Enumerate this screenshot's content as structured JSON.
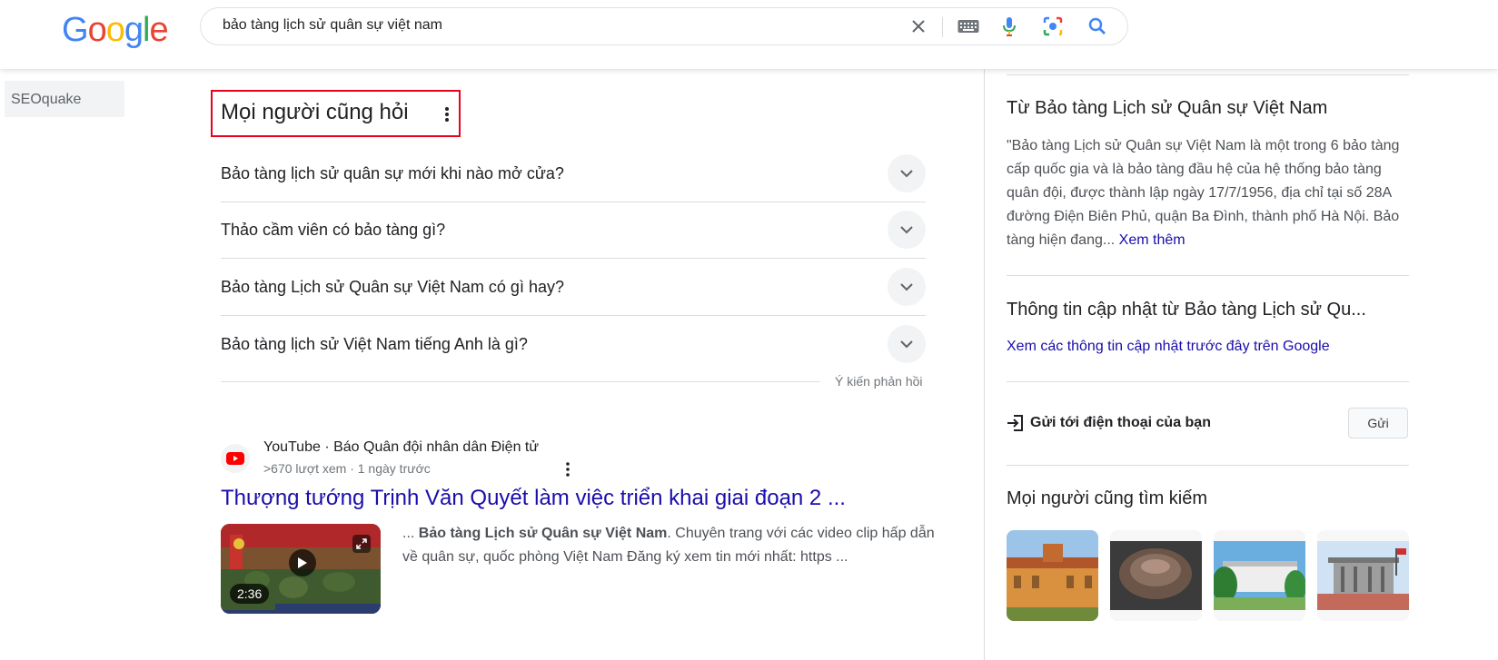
{
  "logo": {
    "letters": [
      "G",
      "o",
      "o",
      "g",
      "l",
      "e"
    ],
    "colors": [
      "#4285f4",
      "#ea4335",
      "#fbbc05",
      "#4285f4",
      "#34a853",
      "#ea4335"
    ]
  },
  "search": {
    "query": "bảo tàng lịch sử quân sự việt nam",
    "icons": [
      "close-icon",
      "keyboard-icon",
      "microphone-icon",
      "lens-icon",
      "search-icon"
    ]
  },
  "seoquake": {
    "label": "SEOquake",
    "enabled": false
  },
  "paa": {
    "title": "Mọi người cũng hỏi",
    "questions": [
      "Bảo tàng lịch sử quân sự mới khi nào mở cửa?",
      "Thảo cầm viên có bảo tàng gì?",
      "Bảo tàng Lịch sử Quân sự Việt Nam có gì hay?",
      "Bảo tàng lịch sử Việt Nam tiếng Anh là gì?"
    ],
    "feedback": "Ý kiến phản hồi"
  },
  "result": {
    "source": "YouTube · Báo Quân đội nhân dân Điện tử",
    "meta": ">670 lượt xem · 1 ngày trước",
    "title": "Thượng tướng Trịnh Văn Quyết làm việc triển khai giai đoạn 2 ...",
    "duration": "2:36",
    "snippet_prefix": "... ",
    "snippet_bold": "Bảo tàng Lịch sử Quân sự Việt Nam",
    "snippet_rest": ". Chuyên trang với các video clip hấp dẫn về quân sự, quốc phòng Việt Nam Đăng ký xem tin mới nhất: https ..."
  },
  "panel": {
    "from_heading": "Từ Bảo tàng Lịch sử Quân sự Việt Nam",
    "description": "\"Bảo tàng Lịch sử Quân sự Việt Nam là một trong 6 bảo tàng cấp quốc gia và là bảo tàng đầu hệ của hệ thống bảo tàng quân đội, được thành lập ngày 17/7/1956, địa chỉ tại số 28A đường Điện Biên Phủ, quận Ba Đình, thành phố Hà Nội. Bảo tàng hiện đang... ",
    "more": "Xem thêm",
    "updates_heading": "Thông tin cập nhật từ Bảo tàng Lịch sử Qu...",
    "updates_link": "Xem các thông tin cập nhật trước đây trên Google",
    "send_label": "Gửi tới điện thoại của bạn",
    "send_button": "Gửi",
    "also_search_heading": "Mọi người cũng tìm kiếm"
  },
  "colors": {
    "link": "#1a0dab",
    "highlight_border": "#e8001c",
    "youtube_red": "#ff0000"
  }
}
